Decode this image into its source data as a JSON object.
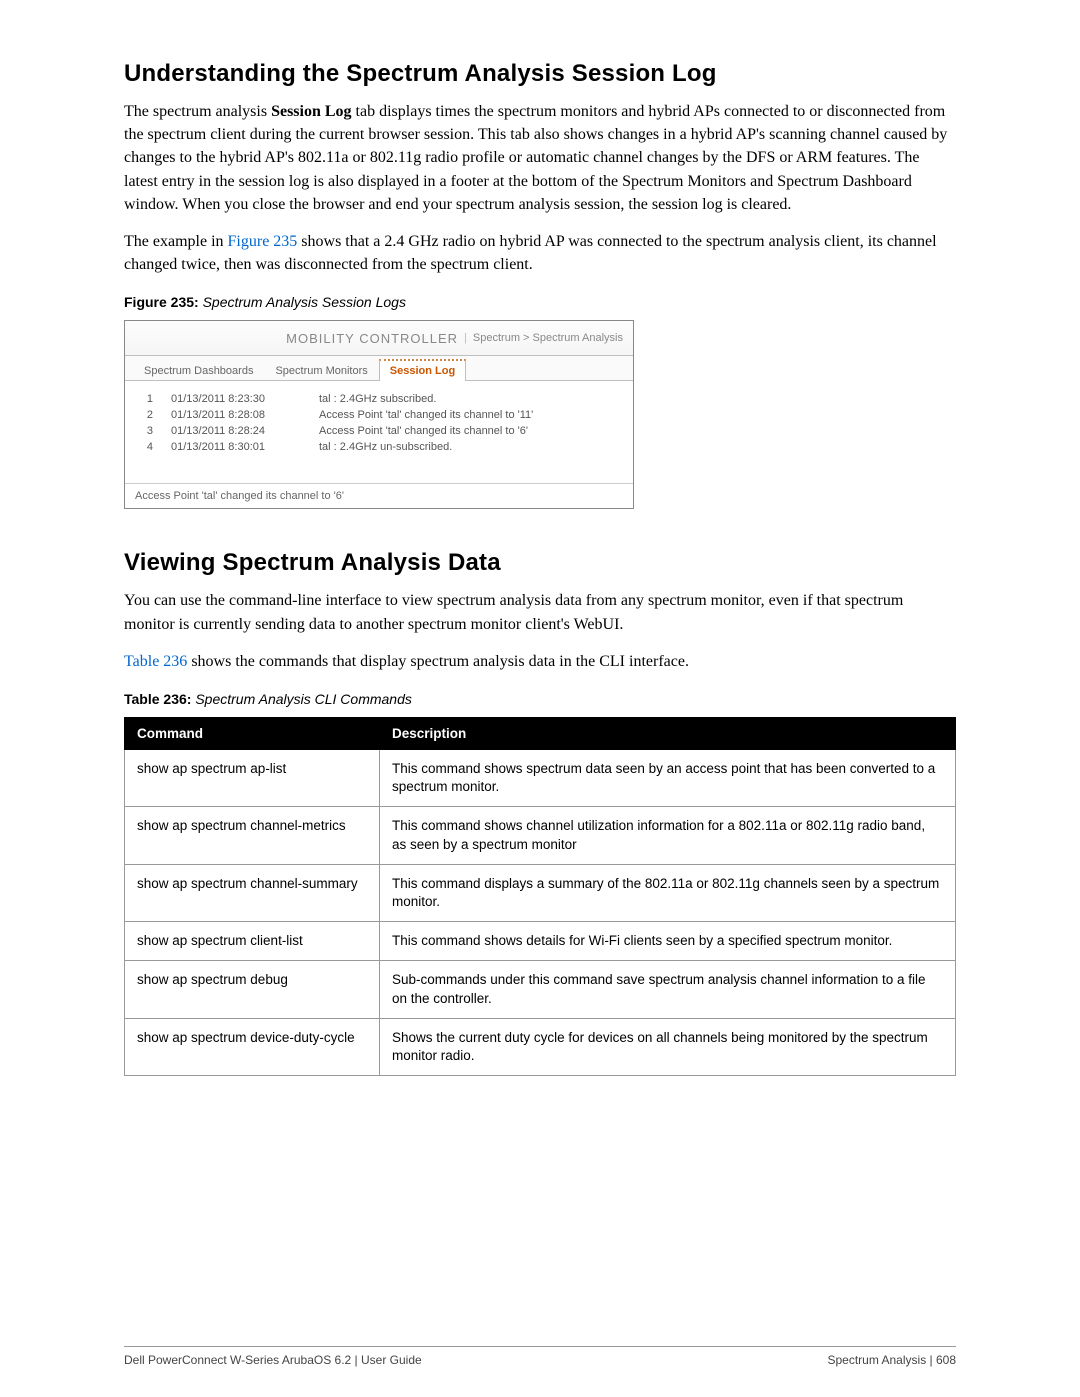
{
  "section1": {
    "heading": "Understanding the Spectrum Analysis Session Log",
    "p1_a": "The spectrum analysis ",
    "p1_bold": "Session Log",
    "p1_b": " tab displays times the spectrum monitors and hybrid APs connected to or disconnected from the spectrum client during the current browser session. This tab also shows changes in a hybrid AP's scanning channel caused by changes to the hybrid AP's 802.11a or 802.11g radio profile or automatic channel changes by the DFS or ARM features. The latest entry in the session log is also displayed in a footer at the bottom of the Spectrum Monitors and Spectrum Dashboard window. When you close the browser and end your spectrum analysis session, the session log is cleared.",
    "p2_a": "The example in ",
    "p2_link": "Figure 235",
    "p2_b": " shows that a 2.4 GHz radio on hybrid AP was connected to the spectrum analysis client, its channel changed twice, then was disconnected from the spectrum client."
  },
  "figure": {
    "label": "Figure 235:",
    "title": "Spectrum Analysis Session Logs",
    "topbar": {
      "title": "MOBILITY CONTROLLER",
      "separator": "|",
      "crumb": "Spectrum > Spectrum Analysis"
    },
    "tabs": {
      "t1": "Spectrum Dashboards",
      "t2": "Spectrum Monitors",
      "t3": "Session Log"
    },
    "rows": [
      {
        "n": "1",
        "ts": "01/13/2011 8:23:30",
        "msg": "tal : 2.4GHz subscribed."
      },
      {
        "n": "2",
        "ts": "01/13/2011 8:28:08",
        "msg": "Access Point 'tal' changed its channel to '11'"
      },
      {
        "n": "3",
        "ts": "01/13/2011 8:28:24",
        "msg": "Access Point 'tal' changed its channel to '6'"
      },
      {
        "n": "4",
        "ts": "01/13/2011 8:30:01",
        "msg": "tal : 2.4GHz un-subscribed."
      }
    ],
    "footer": "Access Point 'tal' changed its channel to '6'"
  },
  "section2": {
    "heading": "Viewing Spectrum Analysis Data",
    "p1": "You can use the command-line interface to view spectrum analysis data from any spectrum monitor, even if that spectrum monitor is currently sending data to another spectrum monitor client's WebUI.",
    "p2_link": "Table 236",
    "p2_b": " shows the commands that display spectrum analysis data in the CLI interface."
  },
  "table": {
    "label": "Table 236:",
    "title": "Spectrum Analysis CLI Commands",
    "head": {
      "c1": "Command",
      "c2": "Description"
    },
    "rows": [
      {
        "cmd": "show ap spectrum ap-list",
        "desc": "This command shows spectrum data seen by an access point that has been converted to a spectrum monitor."
      },
      {
        "cmd": "show ap spectrum channel-metrics",
        "desc": "This command shows channel utilization information for a 802.11a or 802.11g radio band, as seen by a spectrum monitor"
      },
      {
        "cmd": "show ap spectrum channel-summary",
        "desc": "This command displays a summary of the 802.11a or 802.11g channels seen by a spectrum monitor."
      },
      {
        "cmd": "show ap spectrum client-list",
        "desc": "This command shows details for Wi-Fi clients seen by a specified spectrum monitor."
      },
      {
        "cmd": "show ap spectrum debug",
        "desc": "Sub-commands under this command save spectrum analysis channel information to a file on the controller."
      },
      {
        "cmd": "show ap spectrum device-duty-cycle",
        "desc": "Shows the current duty cycle for devices on all channels being monitored by the spectrum monitor radio."
      }
    ]
  },
  "pagefooter": {
    "left": "Dell PowerConnect W-Series ArubaOS 6.2 | User Guide",
    "right": "Spectrum Analysis | 608"
  }
}
